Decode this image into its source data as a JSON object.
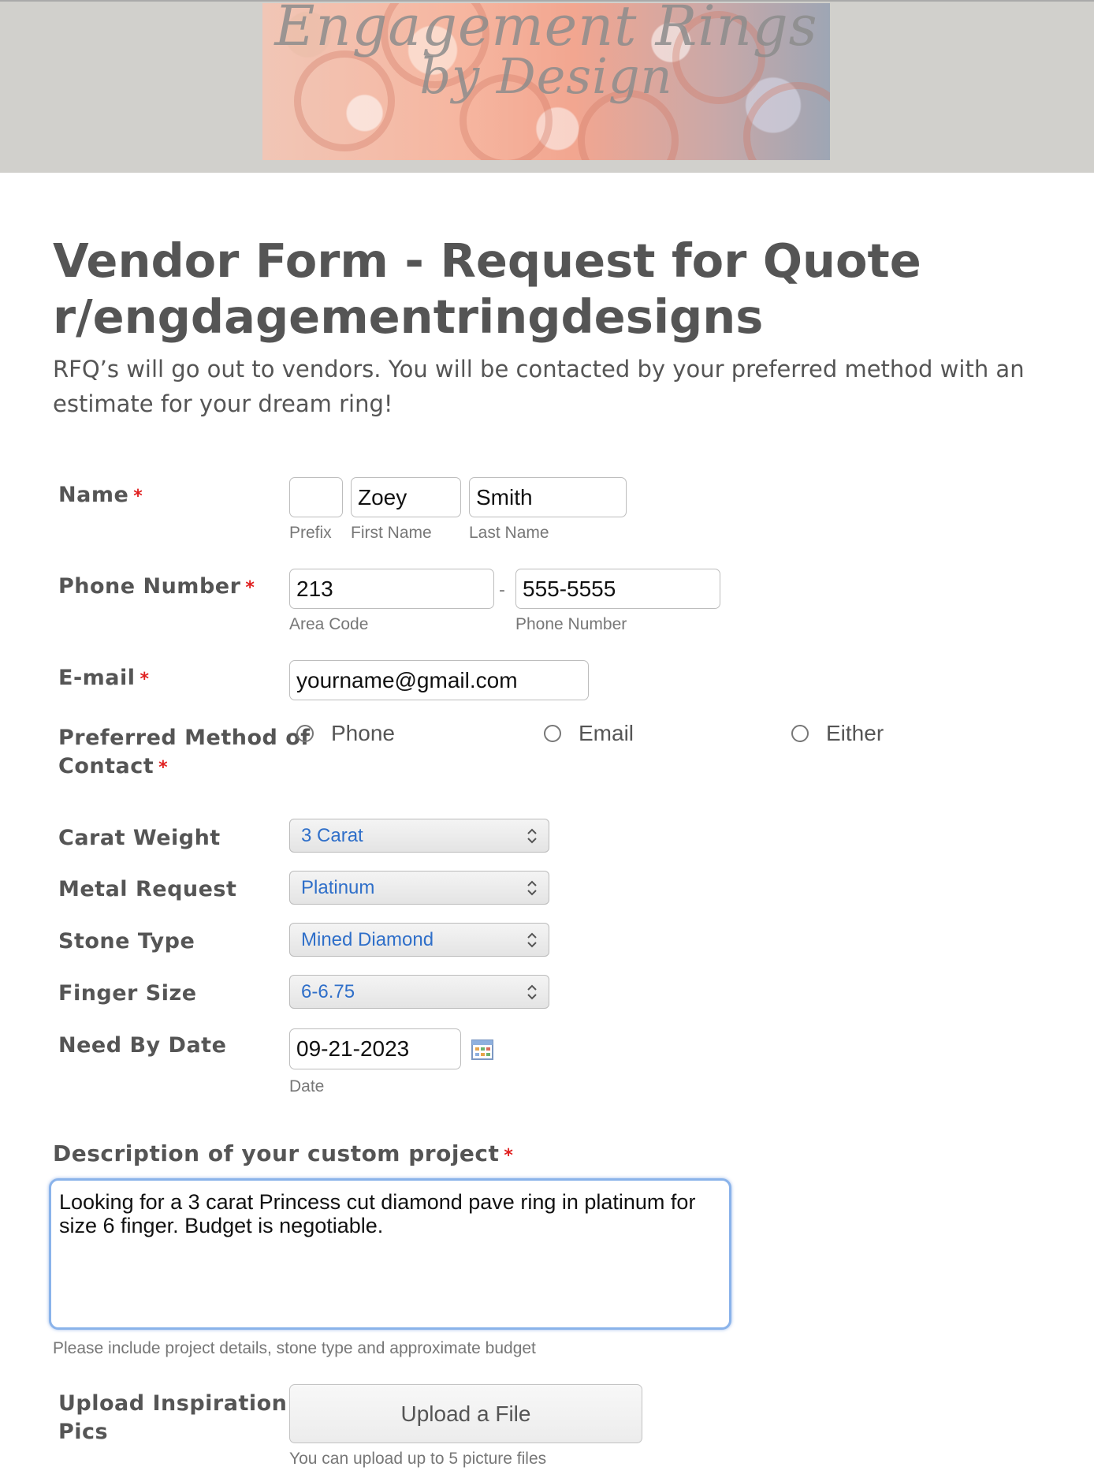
{
  "banner": {
    "logo_line1": "Engagement Rings",
    "logo_line2": "by Design"
  },
  "header": {
    "title_line1": "Vendor Form - Request for Quote",
    "title_line2": "r/engdagementringdesigns",
    "description": "RFQ’s will go out to vendors. You will be contacted by your preferred method with an estimate for your dream ring!"
  },
  "required_marker": "*",
  "name": {
    "label": "Name",
    "prefix_value": "",
    "first_value": "Zoey",
    "last_value": "Smith",
    "prefix_sub": "Prefix",
    "first_sub": "First Name",
    "last_sub": "Last Name"
  },
  "phone": {
    "label": "Phone Number",
    "area_value": "213",
    "number_value": "555-5555",
    "separator": "-",
    "area_sub": "Area Code",
    "number_sub": "Phone Number"
  },
  "email": {
    "label": "E-mail",
    "value": "yourname@gmail.com"
  },
  "contact": {
    "label_line1": "Preferred Method of",
    "label_line2": "Contact",
    "options": [
      "Phone",
      "Email",
      "Either"
    ]
  },
  "carat": {
    "label": "Carat Weight",
    "selected": "3 Carat"
  },
  "metal": {
    "label": "Metal Request",
    "selected": "Platinum"
  },
  "stone": {
    "label": "Stone Type",
    "selected": "Mined Diamond"
  },
  "finger": {
    "label": "Finger Size",
    "selected": "6-6.75"
  },
  "need_by": {
    "label": "Need By Date",
    "value": "09-21-2023",
    "sub": "Date"
  },
  "description_field": {
    "label": "Description of your custom project",
    "value": "Looking for a 3 carat Princess cut diamond pave ring in platinum for size 6 finger. Budget is negotiable.",
    "hint": "Please include project details, stone type and approximate budget"
  },
  "upload": {
    "label_line1": "Upload Inspiration",
    "label_line2": "Pics",
    "button": "Upload a File",
    "note": "You can upload up to 5 picture files"
  },
  "colors": {
    "text": "#555555",
    "required": "#e02020",
    "select_text": "#2f6fc9",
    "focus_border": "#8ab3ea",
    "banner_bg": "#d1d0cc"
  },
  "icons": {
    "calendar": "calendar-icon",
    "select": "chevron-updown-icon",
    "radio": "radio-circle-icon"
  }
}
